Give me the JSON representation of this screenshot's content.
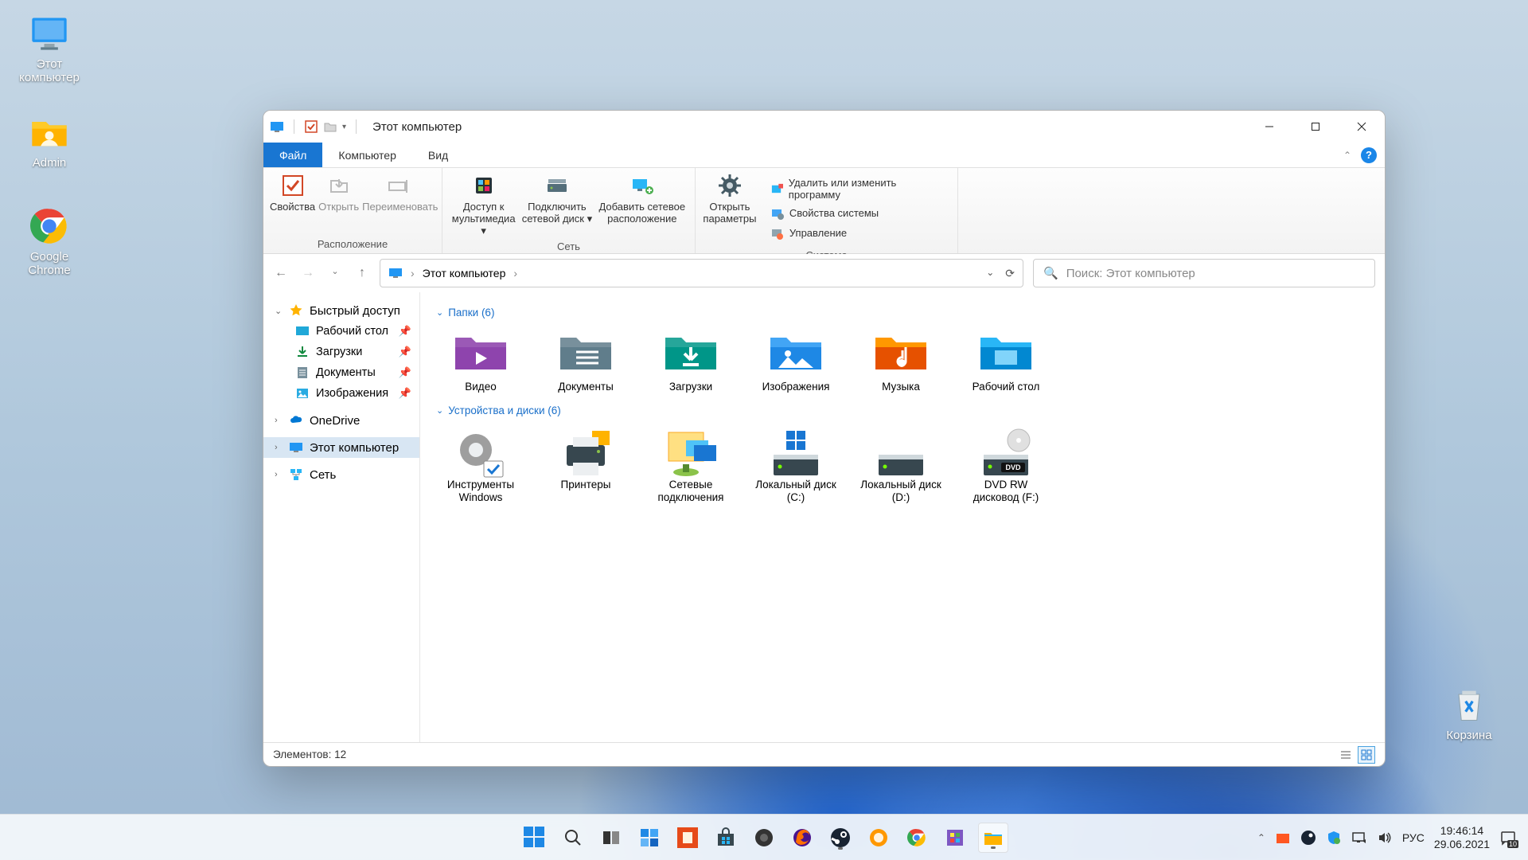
{
  "desktop_icons": {
    "this_pc": "Этот\nкомпьютер",
    "admin": "Admin",
    "chrome": "Google\nChrome",
    "recycle": "Корзина"
  },
  "window": {
    "title": "Этот компьютер",
    "tabs": {
      "file": "Файл",
      "computer": "Компьютер",
      "view": "Вид"
    },
    "ribbon": {
      "location": {
        "label": "Расположение",
        "properties": "Свойства",
        "open": "Открыть",
        "rename": "Переименовать"
      },
      "network": {
        "label": "Сеть",
        "media": "Доступ к\nмультимедиа ▾",
        "map_drive": "Подключить\nсетевой диск ▾",
        "add_loc": "Добавить сетевое\nрасположение"
      },
      "system": {
        "label": "Система",
        "open_settings": "Открыть\nпараметры",
        "uninstall": "Удалить или изменить программу",
        "sys_props": "Свойства системы",
        "manage": "Управление"
      }
    },
    "breadcrumb": "Этот компьютер",
    "search_placeholder": "Поиск: Этот компьютер",
    "sidebar": {
      "quick": "Быстрый доступ",
      "desktop": "Рабочий стол",
      "downloads": "Загрузки",
      "documents": "Документы",
      "pictures": "Изображения",
      "onedrive": "OneDrive",
      "this_pc": "Этот компьютер",
      "network": "Сеть"
    },
    "sections": {
      "folders": "Папки (6)",
      "devices": "Устройства и диски (6)"
    },
    "folders": {
      "video": "Видео",
      "documents": "Документы",
      "downloads": "Загрузки",
      "pictures": "Изображения",
      "music": "Музыка",
      "desktop": "Рабочий стол"
    },
    "devices": {
      "tools": "Инструменты\nWindows",
      "printers": "Принтеры",
      "net_conn": "Сетевые\nподключения",
      "disk_c": "Локальный диск\n(C:)",
      "disk_d": "Локальный диск\n(D:)",
      "dvd": "DVD RW\nдисковод (F:)"
    },
    "status": "Элементов: 12"
  },
  "taskbar": {
    "lang": "РУС",
    "time": "19:46:14",
    "date": "29.06.2021",
    "notif_count": "10"
  }
}
